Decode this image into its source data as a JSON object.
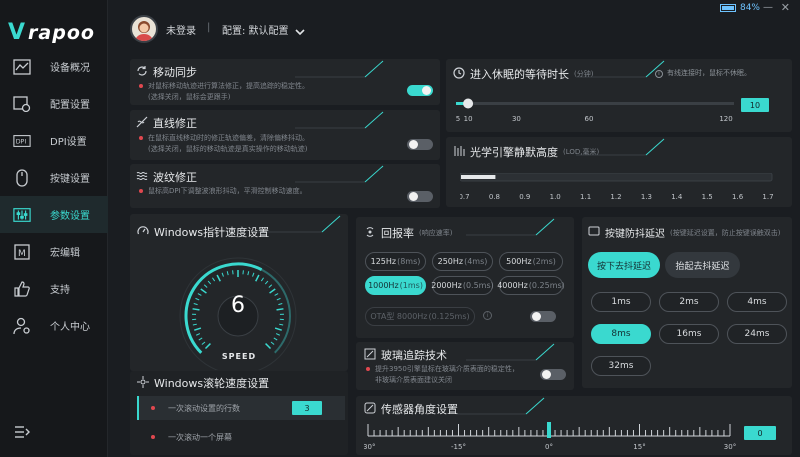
{
  "app": {
    "brand": "rapoo"
  },
  "status": {
    "battery": "84%",
    "battery_level": 0.84,
    "minimize": "—",
    "close": "✕"
  },
  "user": {
    "name": "未登录",
    "separator": "|",
    "config_label": "配置: 默认配置"
  },
  "sidebar": {
    "items": [
      {
        "label": "设备概况",
        "icon": "chart-line-icon"
      },
      {
        "label": "配置设置",
        "icon": "config-icon"
      },
      {
        "label": "DPI设置",
        "icon": "dpi-icon"
      },
      {
        "label": "按键设置",
        "icon": "mouse-icon"
      },
      {
        "label": "参数设置",
        "icon": "sliders-icon",
        "active": true
      },
      {
        "label": "宏编辑",
        "icon": "macro-icon"
      },
      {
        "label": "支持",
        "icon": "thumbs-up-icon"
      },
      {
        "label": "个人中心",
        "icon": "user-gear-icon"
      }
    ]
  },
  "motion_sync": {
    "title": "移动同步",
    "desc1": "对鼠标移动轨迹进行算法修正，提高追踪的稳定性。",
    "desc2": "(选择关闭，鼠标会更跟手)",
    "enabled": true
  },
  "angle_snap": {
    "title": "直线修正",
    "desc1": "在鼠标直线移动时的修正轨迹偏差，清除偏移抖动。",
    "desc2": "(选择关闭，鼠标的移动轨迹是真实操作的移动轨迹)",
    "enabled": false
  },
  "ripple": {
    "title": "波纹修正",
    "desc1": "鼠标高DPI下调整波浪形抖动，平滑控制移动速度。",
    "enabled": false
  },
  "sleep": {
    "title": "进入休眠的等待时长",
    "unit": "(分钟)",
    "hint": "有线连接时，鼠标不休眠。",
    "value": "10",
    "min": 5,
    "max": 120,
    "ticks": [
      "5",
      "10",
      "30",
      "60",
      "120"
    ]
  },
  "lod": {
    "title": "光学引擎静默高度",
    "unit": "(LOD,毫米)",
    "value": 0.8,
    "ticks": [
      "0.7",
      "0.8",
      "0.9",
      "1.0",
      "1.1",
      "1.2",
      "1.3",
      "1.4",
      "1.5",
      "1.6",
      "1.7"
    ]
  },
  "pointer_speed": {
    "title": "Windows指针速度设置",
    "value": "6",
    "max": 10,
    "label": "SPEED"
  },
  "scroll_speed": {
    "title": "Windows滚轮速度设置",
    "option1": "一次滚动设置的行数",
    "option1_value": "3",
    "option2": "一次滚动一个屏幕"
  },
  "polling": {
    "title": "回报率",
    "unit": "(响应速率)",
    "rates": [
      {
        "hz": "125Hz",
        "ms": "(8ms)"
      },
      {
        "hz": "250Hz",
        "ms": "(4ms)"
      },
      {
        "hz": "500Hz",
        "ms": "(2ms)"
      },
      {
        "hz": "1000Hz",
        "ms": "(1ms)",
        "selected": true
      },
      {
        "hz": "2000Hz",
        "ms": "(0.5ms)"
      },
      {
        "hz": "4000Hz",
        "ms": "(0.25ms)"
      }
    ],
    "ota": {
      "hz": "OTA型 8000Hz",
      "ms": "(0.125ms)"
    },
    "ota_enabled": false
  },
  "glass": {
    "title": "玻璃追踪技术",
    "desc1": "提升3950引擎鼠标在玻璃介质表面的稳定性，",
    "desc2": "非玻璃介质表面建议关闭",
    "enabled": false
  },
  "sensor_angle": {
    "title": "传感器角度设置",
    "value": "0",
    "ticks": [
      "-30°",
      "-15°",
      "0°",
      "15°",
      "30°"
    ]
  },
  "debounce": {
    "title": "按键防抖延迟",
    "subtitle": "(按键延迟设置，防止按键误触双击)",
    "press": "按下去抖延迟",
    "release": "抬起去抖延迟",
    "values": [
      "1ms",
      "2ms",
      "4ms",
      "8ms",
      "16ms",
      "24ms",
      "32ms"
    ],
    "selected": "8ms"
  },
  "colors": {
    "accent": "#3ad9cf",
    "danger": "#e0484f",
    "panel": "#232629",
    "bg": "#1a1d21"
  }
}
